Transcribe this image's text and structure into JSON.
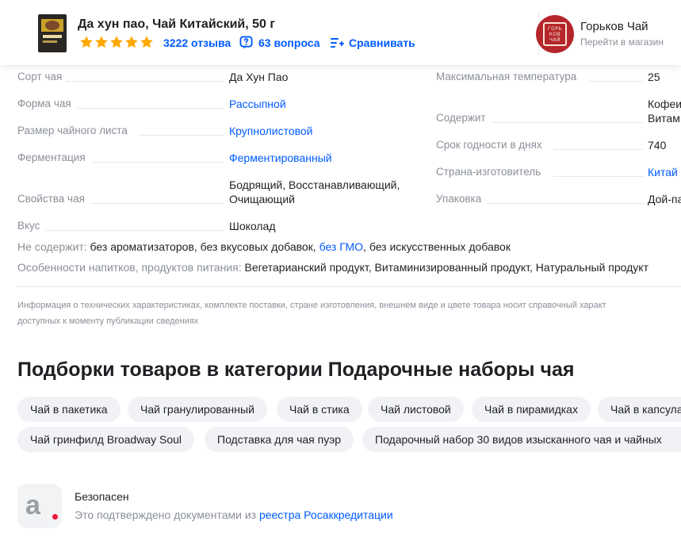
{
  "header": {
    "product_title": "Да хун пао, Чай Китайский, 50 г",
    "rating_stars": 5,
    "reviews_label": "3222 отзыва",
    "questions_label": "63 вопроса",
    "compare_label": "Сравнивать",
    "star_color": "#ffa800",
    "accent_color": "#005bff",
    "shop": {
      "name": "Горьков Чай",
      "link_label": "Перейти в магазин",
      "logo_text": "ГОРЬ КОВ ЧАЙ",
      "logo_color": "#b5262a"
    }
  },
  "specs_left": [
    {
      "label": "Сорт чая",
      "value": "Да Хун Пао",
      "link": false
    },
    {
      "label": "Форма чая",
      "value": "Рассыпной",
      "link": true
    },
    {
      "label": "Размер чайного листа",
      "value": "Крупнолистовой",
      "link": true
    },
    {
      "label": "Ферментация",
      "value": "Ферментированный",
      "link": true
    },
    {
      "label": "Свойства чая",
      "value_line1": "Бодрящий, Восстанавливающий,",
      "value_line2": "Очищающий",
      "link": false
    },
    {
      "label": "Вкус",
      "value": "Шоколад",
      "link": false
    }
  ],
  "specs_right": [
    {
      "label": "Максимальная температура",
      "value": "25",
      "link": false
    },
    {
      "label": "Содержит",
      "value_line1": "Кофеи",
      "value_line2": "Витам",
      "link": false
    },
    {
      "label": "Срок годности в днях",
      "value": "740",
      "link": false
    },
    {
      "label": "Страна-изготовитель",
      "value": "Китай",
      "link": true
    },
    {
      "label": "Упаковка",
      "value": "Дой-па",
      "link": false
    }
  ],
  "not_contains": {
    "label": "Не содержит:",
    "part1": "без ароматизаторов, без вкусовых добавок,",
    "link": "без ГМО",
    "part2": ", без искусственных добавок"
  },
  "features": {
    "label": "Особенности напитков, продуктов питания:",
    "value": "Вегетарианский продукт, Витаминизированный продукт, Натуральный продукт"
  },
  "disclaimer": {
    "line1": "Информация о технических характеристиках, комплекте поставки, стране изготовления, внешнем виде и цвете товара носит справочный характ",
    "line2": "доступных к моменту публикации сведениях"
  },
  "collections": {
    "title": "Подборки товаров в категории Подарочные наборы чая",
    "row1": [
      "Чай в пакетика",
      "Чай гранулированный",
      "Чай в стика",
      "Чай листовой",
      "Чай в пирамидках",
      "Чай в капсула"
    ],
    "row2": [
      "Чай гринфилд Broadway Soul",
      "Подставка для чая пуэр",
      "Подарочный набор 30 видов изысканного чая и чайных"
    ]
  },
  "safety": {
    "title": "Безопасен",
    "text": "Это подтверждено документами из",
    "link": "реестра Росаккредитации",
    "dot_color": "#f1173e"
  }
}
